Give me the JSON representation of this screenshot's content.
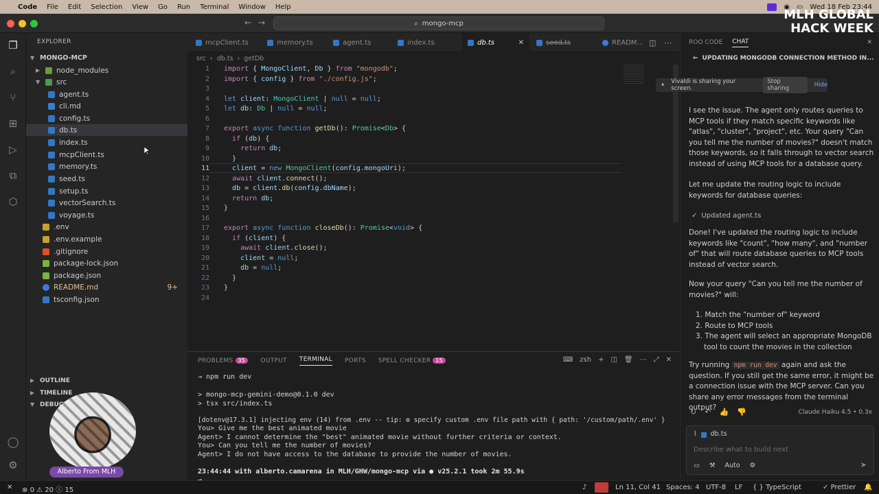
{
  "menubar": {
    "app": "Code",
    "items": [
      "File",
      "Edit",
      "Selection",
      "View",
      "Go",
      "Run",
      "Terminal",
      "Window",
      "Help"
    ],
    "datetime": "Wed 18 Feb 23:44"
  },
  "titlebar": {
    "search": "mongo-mcp"
  },
  "explorer": {
    "header": "EXPLORER",
    "project": "MONGO-MCP",
    "items": [
      {
        "label": "node_modules",
        "type": "folder"
      },
      {
        "label": "src",
        "type": "folder-open"
      },
      {
        "label": "agent.ts",
        "type": "ts"
      },
      {
        "label": "cli.md",
        "type": "md"
      },
      {
        "label": "config.ts",
        "type": "ts"
      },
      {
        "label": "db.ts",
        "type": "ts"
      },
      {
        "label": "index.ts",
        "type": "ts"
      },
      {
        "label": "mcpClient.ts",
        "type": "ts"
      },
      {
        "label": "memory.ts",
        "type": "ts"
      },
      {
        "label": "seed.ts",
        "type": "ts"
      },
      {
        "label": "setup.ts",
        "type": "ts"
      },
      {
        "label": "vectorSearch.ts",
        "type": "ts"
      },
      {
        "label": "voyage.ts",
        "type": "ts"
      },
      {
        "label": ".env",
        "type": "env"
      },
      {
        "label": ".env.example",
        "type": "env"
      },
      {
        "label": ".gitignore",
        "type": "git"
      },
      {
        "label": "package-lock.json",
        "type": "json"
      },
      {
        "label": "package.json",
        "type": "json"
      },
      {
        "label": "README.md",
        "type": "info"
      },
      {
        "label": "tsconfig.json",
        "type": "json"
      }
    ],
    "readme_badge": "9+",
    "sections": [
      "OUTLINE",
      "TIMELINE",
      "DEBUG"
    ]
  },
  "tabs": [
    {
      "label": "mcpClient.ts"
    },
    {
      "label": "memory.ts"
    },
    {
      "label": "agent.ts"
    },
    {
      "label": "index.ts"
    },
    {
      "label": "db.ts"
    },
    {
      "label": "seed.ts"
    },
    {
      "label": "READM..."
    }
  ],
  "breadcrumb": [
    "src",
    "db.ts",
    "getDb"
  ],
  "editor": {
    "current_line": 11,
    "line_count": 24
  },
  "panel": {
    "tabs": [
      "PROBLEMS",
      "OUTPUT",
      "TERMINAL",
      "PORTS",
      "SPELL CHECKER"
    ],
    "problems_count": "35",
    "spell_count": "15",
    "shell": "zsh",
    "lines": [
      "→ npm run dev",
      "",
      "> mongo-mcp-gemini-demo@0.1.0 dev",
      "> tsx src/index.ts",
      "",
      "[dotenv@17.3.1] injecting env (14) from .env -- tip: ⚙ specify custom .env file path with { path: '/custom/path/.env' }",
      "You> Give me the best animated movie",
      "Agent> I cannot determine the \"best\" animated movie without further criteria or context.",
      "You> Can you tell me the number of movies?",
      "Agent> I do not have access to the database to provide the number of movies.",
      "",
      "23:44:44 with alberto.camarena in MLH/GHW/mongo-mcp via ● v25.2.1 took 2m 55.9s",
      "→"
    ]
  },
  "chat": {
    "tabs": [
      "ROO CODE",
      "CHAT"
    ],
    "title": "UPDATING MONGODB CONNECTION METHOD IN...",
    "share_notice": "Vivaldi is sharing your screen.",
    "stop_sharing": "Stop sharing",
    "hide": "Hide",
    "para1": "I see the issue. The agent only routes queries to MCP tools if they match specific keywords like \"atlas\", \"cluster\", \"project\", etc. Your query \"Can you tell me the number of movies?\" doesn't match those keywords, so it falls through to vector search instead of using MCP tools for a database query.",
    "para2": "Let me update the routing logic to include keywords for database queries:",
    "updated": "Updated agent.ts",
    "para3": "Done! I've updated the routing logic to include keywords like \"count\", \"how many\", and \"number of\" that will route database queries to MCP tools instead of vector search.",
    "para4": "Now your query \"Can you tell me the number of movies?\" will:",
    "steps": [
      "Match the \"number of\" keyword",
      "Route to MCP tools",
      "The agent will select an appropriate MongoDB tool to count the movies in the collection"
    ],
    "para5a": "Try running ",
    "para5code": "npm run dev",
    "para5b": " again and ask the question. If you still get the same error, it might be a connection issue with the MCP server. Can you share any error messages from the terminal output?",
    "model": "Claude Haiku 4.5 • 0.3x",
    "attachment": "db.ts",
    "input_placeholder": "Describe what to build next",
    "mode": "Auto"
  },
  "status": {
    "errors": "0",
    "warnings": "20",
    "info": "15",
    "position": "Ln 11, Col 41",
    "spaces": "Spaces: 4",
    "encoding": "UTF-8",
    "eol": "LF",
    "language": "TypeScript",
    "formatter": "Prettier"
  },
  "overlay": {
    "logo_line1": "MLH GLOBAL",
    "logo_line2": "HACK WEEK",
    "presenter": "Alberto From MLH"
  }
}
